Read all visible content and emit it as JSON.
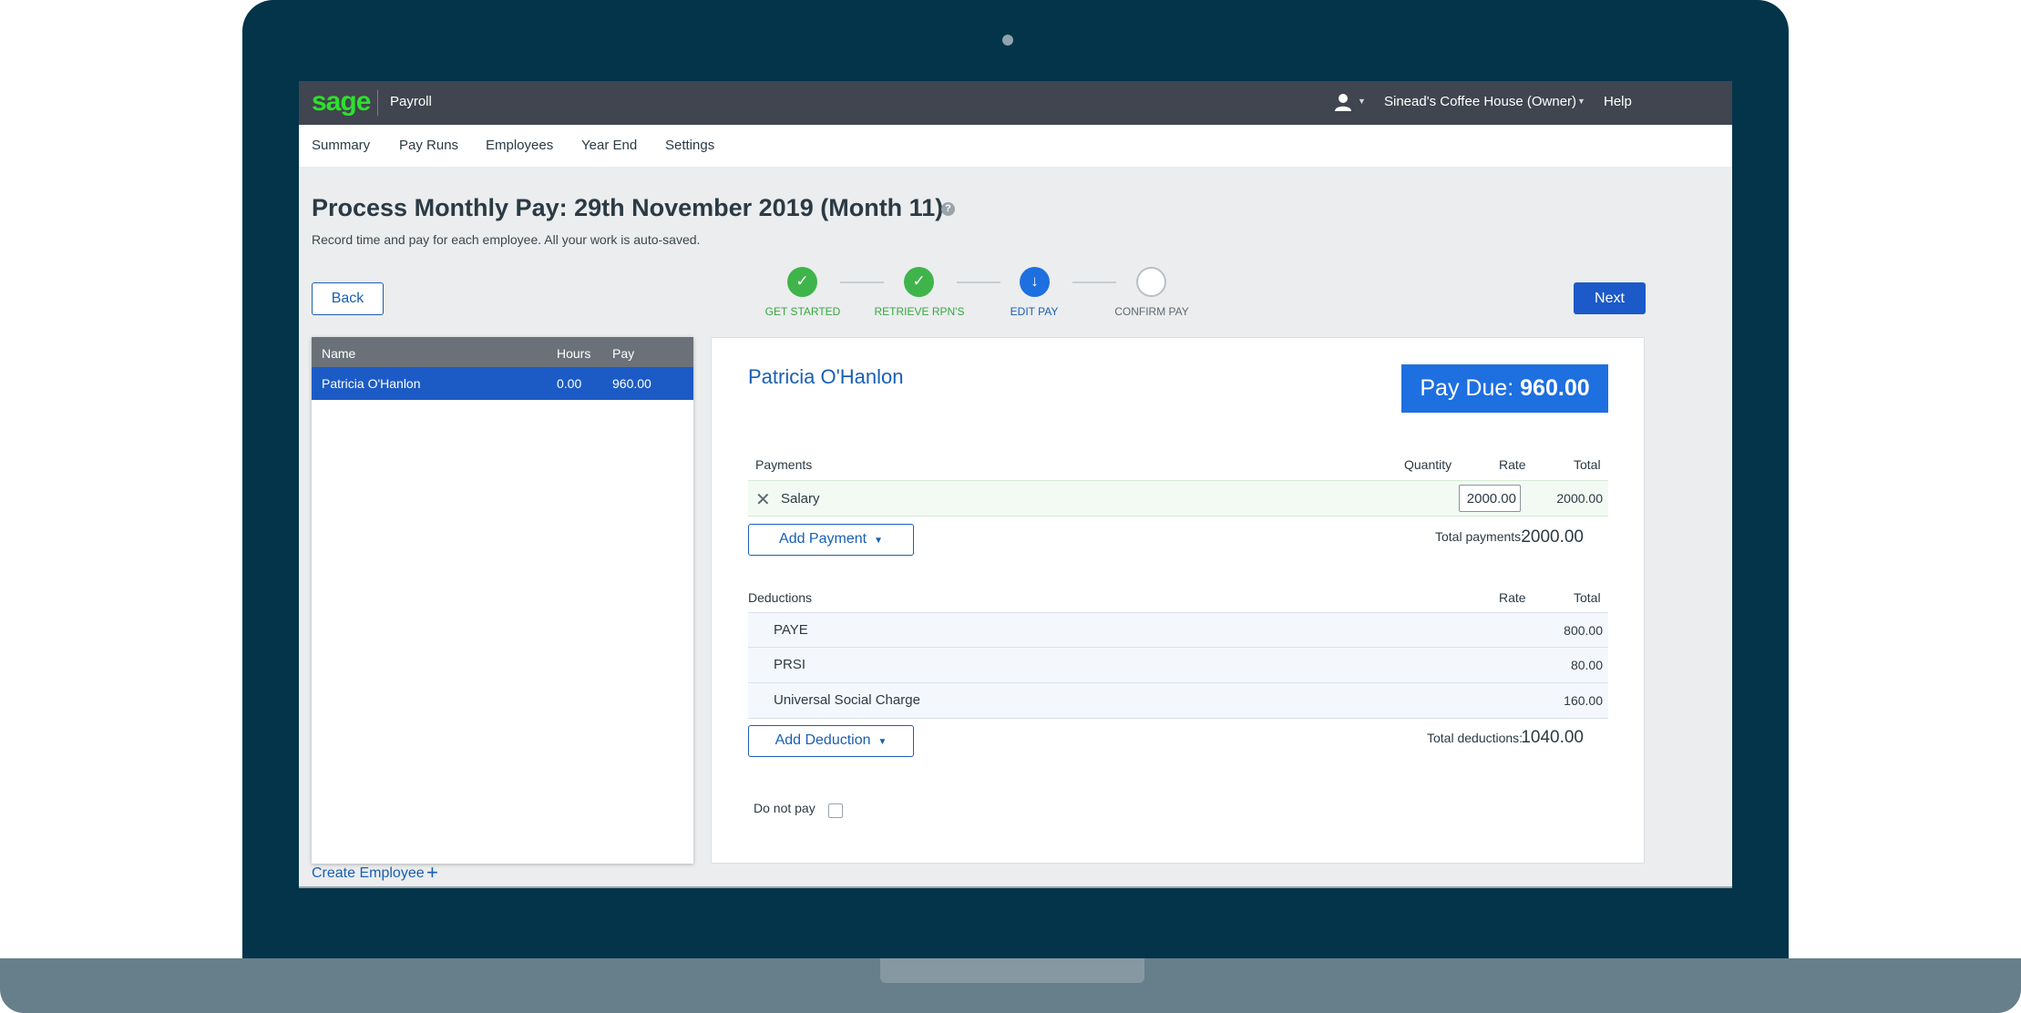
{
  "app": {
    "logo": "sage",
    "name": "Payroll",
    "company": "Sinead's Coffee House (Owner)",
    "help": "Help"
  },
  "nav": {
    "items": [
      "Summary",
      "Pay Runs",
      "Employees",
      "Year End",
      "Settings"
    ]
  },
  "page": {
    "title": "Process Monthly Pay: 29th November 2019 (Month 11)",
    "help_icon": "?",
    "subtitle": "Record time and pay for each employee. All your work is auto-saved.",
    "back_label": "Back",
    "next_label": "Next"
  },
  "stepper": {
    "steps": [
      {
        "label": "GET STARTED",
        "status": "done",
        "icon": "✓"
      },
      {
        "label": "RETRIEVE RPN'S",
        "status": "done",
        "icon": "✓"
      },
      {
        "label": "EDIT PAY",
        "status": "current",
        "icon": "↓"
      },
      {
        "label": "CONFIRM PAY",
        "status": "todo",
        "icon": ""
      }
    ]
  },
  "employees": {
    "headers": {
      "name": "Name",
      "hours": "Hours",
      "pay": "Pay"
    },
    "rows": [
      {
        "name": "Patricia O'Hanlon",
        "hours": "0.00",
        "pay": "960.00",
        "selected": true
      }
    ],
    "create_label": "Create Employee",
    "create_icon": "+"
  },
  "detail": {
    "employee_name": "Patricia O'Hanlon",
    "pay_due_label": "Pay Due:",
    "pay_due_value": "960.00",
    "payments": {
      "heading": "Payments",
      "col_quantity": "Quantity",
      "col_rate": "Rate",
      "col_total": "Total",
      "rows": [
        {
          "label": "Salary",
          "rate": "2000.00",
          "total": "2000.00"
        }
      ],
      "add_label": "Add Payment",
      "total_label": "Total payments:",
      "total_value": "2000.00"
    },
    "deductions": {
      "heading": "Deductions",
      "col_rate": "Rate",
      "col_total": "Total",
      "rows": [
        {
          "label": "PAYE",
          "total": "800.00"
        },
        {
          "label": "PRSI",
          "total": "80.00"
        },
        {
          "label": "Universal Social Charge",
          "total": "160.00"
        }
      ],
      "add_label": "Add Deduction",
      "total_label": "Total deductions:",
      "total_value": "1040.00"
    },
    "do_not_pay_label": "Do not pay"
  },
  "colors": {
    "brand_green": "#2ee02c",
    "primary_blue": "#1b5ac8",
    "step_done": "#3fb44a",
    "frame": "#03344a"
  }
}
